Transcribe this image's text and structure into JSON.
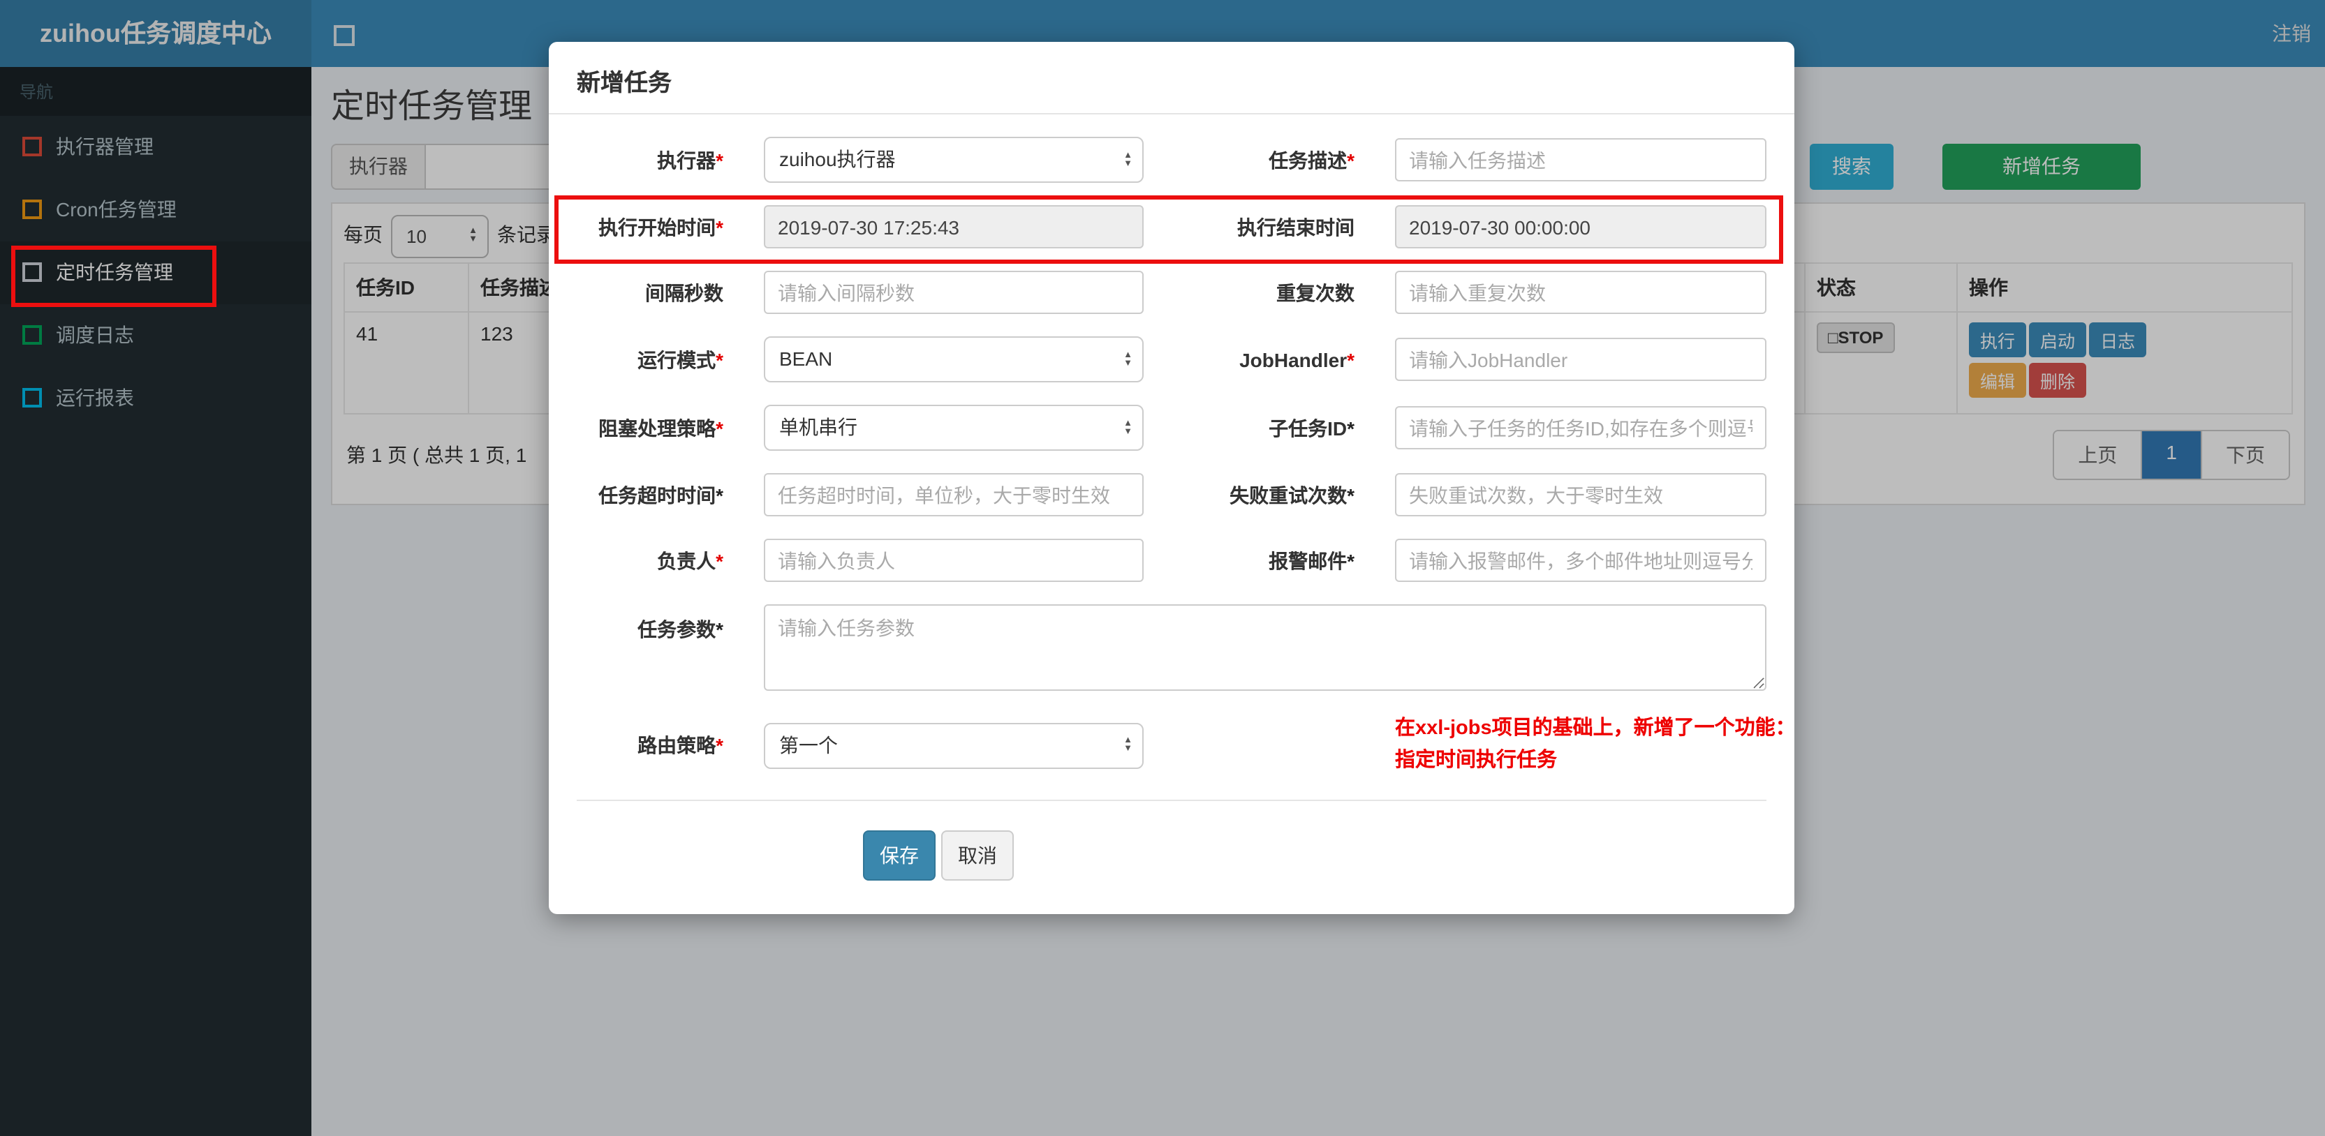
{
  "navbar": {
    "brand": "zuihou任务调度中心",
    "logout_label": "注销"
  },
  "sidebar": {
    "nav_label": "导航",
    "items": [
      {
        "label": "执行器管理",
        "icon_color": "#dd4b39",
        "active": false
      },
      {
        "label": "Cron任务管理",
        "icon_color": "#f39c12",
        "active": false
      },
      {
        "label": "定时任务管理",
        "icon_color": "#d2d6de",
        "active": true
      },
      {
        "label": "调度日志",
        "icon_color": "#00a65a",
        "active": false
      },
      {
        "label": "运行报表",
        "icon_color": "#00c0ef",
        "active": false
      }
    ]
  },
  "page": {
    "title": "定时任务管理"
  },
  "filter": {
    "executor_label": "执行器"
  },
  "toolbar": {
    "search_label": "搜索",
    "add_label": "新增任务"
  },
  "perpage": {
    "prefix": "每页",
    "value": "10",
    "suffix": "条记录"
  },
  "table": {
    "headers": [
      "任务ID",
      "任务描述",
      "状态",
      "操作"
    ],
    "row": {
      "id": "41",
      "desc": "123",
      "status_icon": "□",
      "status": "STOP",
      "actions": [
        "执行",
        "启动",
        "日志",
        "编辑",
        "删除"
      ]
    }
  },
  "pagination": {
    "summary": "第 1 页 ( 总共 1 页, 1",
    "prev": "上页",
    "page": "1",
    "next": "下页"
  },
  "modal": {
    "title": "新增任务",
    "fields": {
      "executor": {
        "label": "执行器",
        "star": "*",
        "value": "zuihou执行器"
      },
      "job_desc": {
        "label": "任务描述",
        "star": "*",
        "placeholder": "请输入任务描述"
      },
      "start_time": {
        "label": "执行开始时间",
        "star": "*",
        "value": "2019-07-30 17:25:43"
      },
      "end_time": {
        "label": "执行结束时间",
        "value": "2019-07-30 00:00:00"
      },
      "interval": {
        "label": "间隔秒数",
        "placeholder": "请输入间隔秒数"
      },
      "repeat": {
        "label": "重复次数",
        "placeholder": "请输入重复次数"
      },
      "glue_type": {
        "label": "运行模式",
        "star": "*",
        "value": "BEAN"
      },
      "job_handler": {
        "label": "JobHandler",
        "star": "*",
        "placeholder": "请输入JobHandler"
      },
      "block_strategy": {
        "label": "阻塞处理策略",
        "star": "*",
        "value": "单机串行"
      },
      "child_jobid": {
        "label": "子任务ID",
        "star": "*",
        "placeholder": "请输入子任务的任务ID,如存在多个则逗号分隔"
      },
      "timeout": {
        "label": "任务超时时间",
        "star": "*",
        "placeholder": "任务超时时间，单位秒，大于零时生效"
      },
      "fail_retry": {
        "label": "失败重试次数",
        "star": "*",
        "placeholder": "失败重试次数，大于零时生效"
      },
      "author": {
        "label": "负责人",
        "star": "*",
        "placeholder": "请输入负责人"
      },
      "alarm_email": {
        "label": "报警邮件",
        "star": "*",
        "placeholder": "请输入报警邮件，多个邮件地址则逗号分隔"
      },
      "job_param": {
        "label": "任务参数",
        "star": "*",
        "placeholder": "请输入任务参数"
      },
      "route_strategy": {
        "label": "路由策略",
        "star": "*",
        "value": "第一个"
      }
    },
    "note_line1": "在xxl-jobs项目的基础上，新增了一个功能：",
    "note_line2": "指定时间执行任务",
    "save_label": "保存",
    "cancel_label": "取消"
  },
  "colors": {
    "navbar": "#3c8dbc",
    "brand_bg": "#367fa9",
    "sidebar": "#222d32",
    "search_btn": "#31b0d5",
    "add_btn": "#23a35c",
    "primary_btn": "#3a87ad",
    "warn_btn": "#f0ad4e",
    "danger_btn": "#d9534f",
    "active_page": "#337ab7",
    "annotation": "#ec0f0f"
  }
}
